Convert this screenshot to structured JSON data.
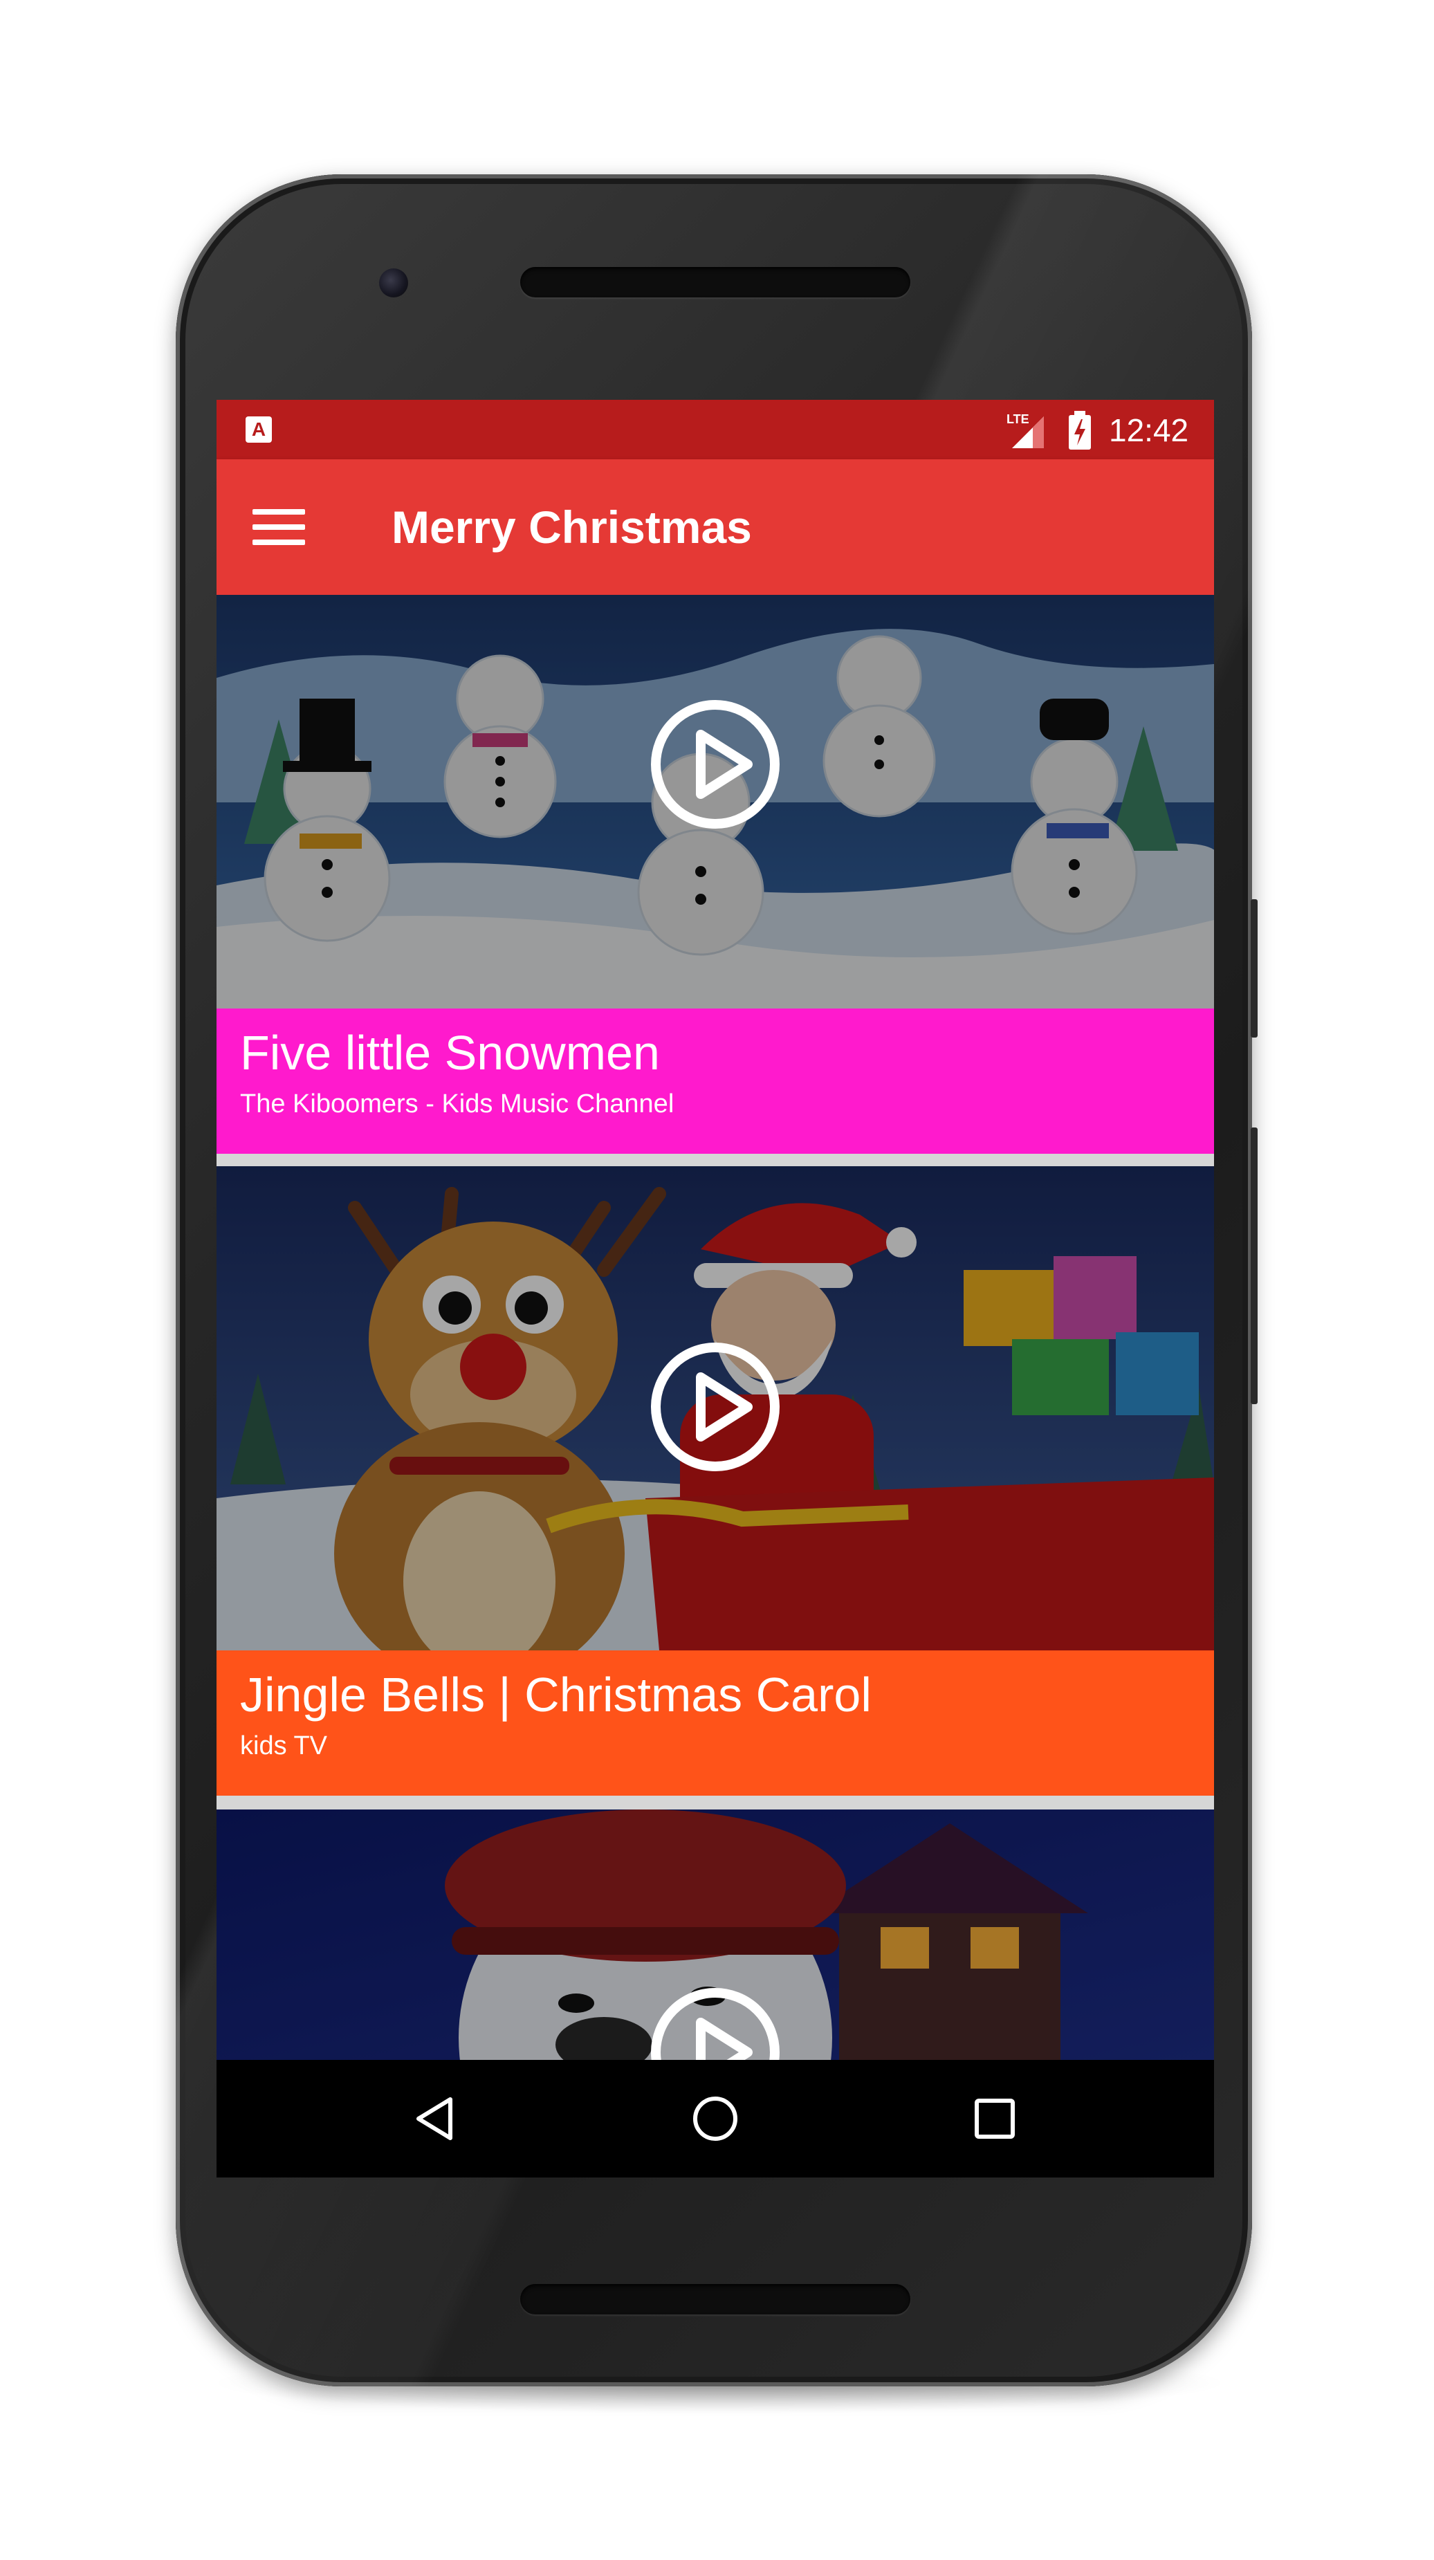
{
  "status_bar": {
    "app_icon_glyph": "A",
    "network_icon": "lte-signal-icon",
    "battery_icon": "battery-charging-icon",
    "time": "12:42"
  },
  "toolbar": {
    "menu_icon": "hamburger-menu-icon",
    "title": "Merry Christmas",
    "color": "#e53935"
  },
  "videos": [
    {
      "title": "Five little Snowmen",
      "channel": "The Kiboomers - Kids Music Channel",
      "footer_color": "#ff1acd",
      "thumbnail": "snowmen-thumbnail",
      "play_icon": "play-circle-icon"
    },
    {
      "title": "Jingle Bells | Christmas Carol",
      "channel": "kids TV",
      "footer_color": "#ff5319",
      "thumbnail": "santa-reindeer-thumbnail",
      "play_icon": "play-circle-icon"
    },
    {
      "title": "",
      "channel": "",
      "thumbnail": "snowman-house-thumbnail",
      "play_icon": "play-circle-icon"
    }
  ],
  "navigation": {
    "back_icon": "back-triangle-icon",
    "home_icon": "home-circle-icon",
    "recents_icon": "recents-square-icon"
  },
  "colors": {
    "status_bar": "#b71c1c",
    "nav_bar": "#000000"
  }
}
